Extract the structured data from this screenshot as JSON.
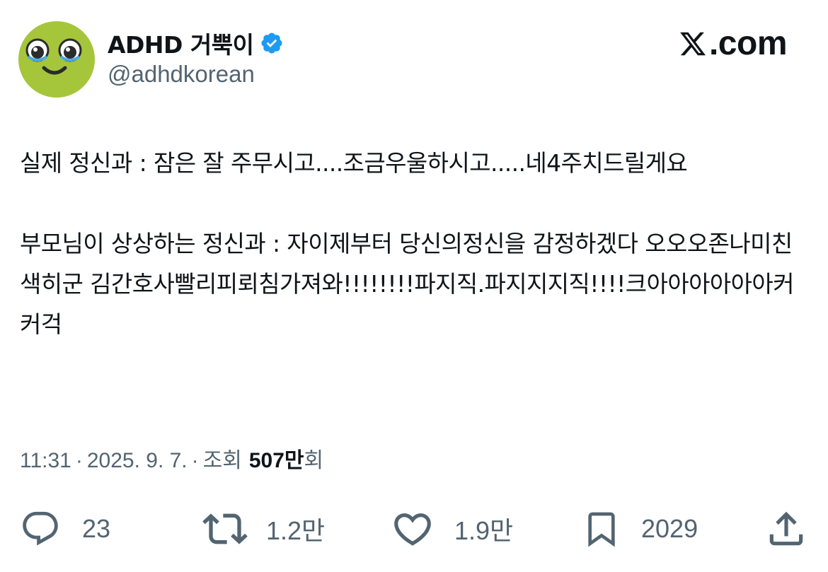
{
  "author": {
    "display_name": "ADHD 거뿍이",
    "handle": "@adhdkorean",
    "verified": true,
    "avatar": "smiling-green-face-avatar"
  },
  "brand": {
    "logo_icon": "x-logo-icon",
    "site_label": ".com"
  },
  "tweet": {
    "paragraph_1": "실제 정신과 : 잠은 잘 주무시고....조금우울하시고.....네4주치드릴게요",
    "paragraph_2": "부모님이 상상하는 정신과 : 자이제부터 당신의정신을 감정하겠다 오오오존나미친색히군 김간호사빨리피뢰침가져와!!!!!!!!파지직.파지지지직!!!!크아아아아아아커커걱"
  },
  "meta": {
    "time": "11:31",
    "separator_1": "·",
    "date": "2025. 9. 7.",
    "separator_2": "·",
    "views_label": "조회",
    "views_count": "507만",
    "views_suffix": "회"
  },
  "actions": {
    "replies": "23",
    "retweets": "1.2만",
    "likes": "1.9만",
    "bookmarks": "2029"
  },
  "colors": {
    "text_primary": "#0f1419",
    "text_secondary": "#536471",
    "verified_blue": "#1d9bf0",
    "avatar_green": "#a5c63b"
  }
}
